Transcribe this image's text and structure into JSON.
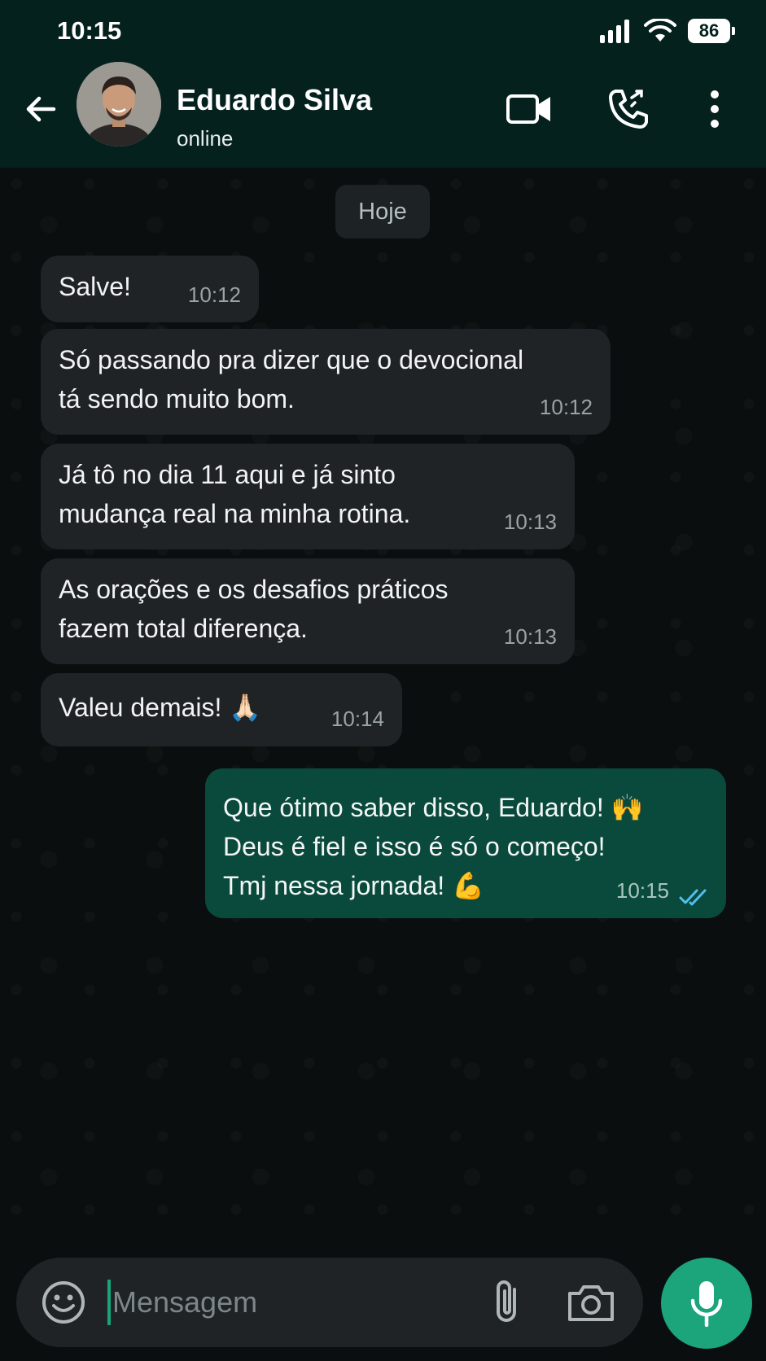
{
  "status_bar": {
    "time": "10:15",
    "battery": "86",
    "icons": [
      "signal-icon",
      "wifi-icon",
      "battery-icon"
    ]
  },
  "header": {
    "name": "Eduardo Silva",
    "status": "online",
    "icons": [
      "back-arrow-icon",
      "video-call-icon",
      "voice-call-icon",
      "more-options-icon"
    ]
  },
  "chat": {
    "date_chip": "Hoje",
    "messages": [
      {
        "text": "Salve!",
        "time": "10:12",
        "direction": "in"
      },
      {
        "lines": [
          "Só passando pra dizer que o devocional",
          "tá sendo muito bom."
        ],
        "time": "10:12",
        "direction": "in"
      },
      {
        "lines": [
          "Já tô no dia 11 aqui e já sinto",
          "mudança real na minha rotina."
        ],
        "time": "10:13",
        "direction": "in"
      },
      {
        "lines": [
          "As orações e os desafios práticos",
          "fazem total diferença."
        ],
        "time": "10:13",
        "direction": "in"
      },
      {
        "text": "Valeu demais! 🙏🏻",
        "time": "10:14",
        "direction": "in"
      },
      {
        "lines": [
          "Que ótimo saber disso, Eduardo! 🙌",
          "Deus é fiel e isso é só o começo!",
          "Tmj nessa jornada! 💪"
        ],
        "time": "10:15",
        "direction": "out",
        "read": true
      }
    ]
  },
  "composer": {
    "placeholder": "Mensagem",
    "value": ""
  },
  "colors": {
    "header_bg": "#04211d",
    "chat_bg": "#0b0e0e",
    "incoming_bubble": "#1f2325",
    "outgoing_bubble": "#0a4a3c",
    "accent": "#1ca47a",
    "read_ticks": "#53bdeb"
  }
}
